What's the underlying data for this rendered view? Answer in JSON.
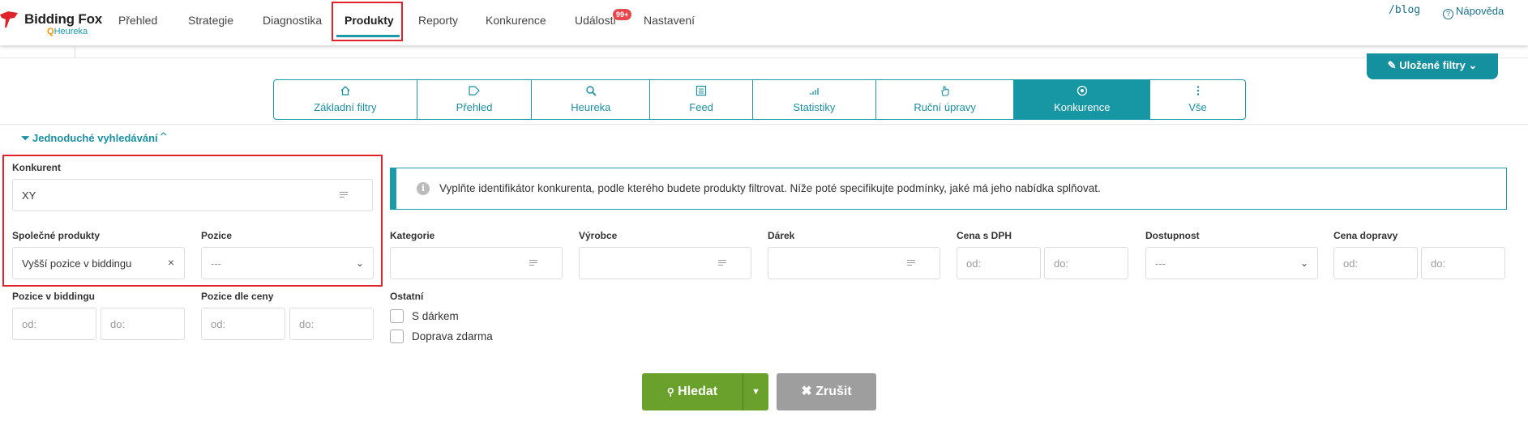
{
  "nav": {
    "brand": "Bidding Fox",
    "sub_brand": "Heureka",
    "items": [
      {
        "label": "Přehled"
      },
      {
        "label": "Strategie"
      },
      {
        "label": "Diagnostika"
      },
      {
        "label": "Produkty"
      },
      {
        "label": "Reporty"
      },
      {
        "label": "Konkurence"
      },
      {
        "label": "Události"
      },
      {
        "label": "Nastavení"
      }
    ],
    "active": "Produkty",
    "events_badge": "99+",
    "blog": "/blog",
    "help": "Nápověda"
  },
  "saved_filters": "Uložené filtry",
  "tabs": [
    {
      "label": "Základní filtry",
      "icon": "home-icon"
    },
    {
      "label": "Přehled",
      "icon": "tag-icon"
    },
    {
      "label": "Heureka",
      "icon": "search-zoom-icon"
    },
    {
      "label": "Feed",
      "icon": "list-icon"
    },
    {
      "label": "Statistiky",
      "icon": "bars-icon"
    },
    {
      "label": "Ruční úpravy",
      "icon": "hand-icon"
    },
    {
      "label": "Konkurence",
      "icon": "competition-icon"
    },
    {
      "label": "Vše",
      "icon": "dots-vertical-icon"
    }
  ],
  "active_tab": "Konkurence",
  "simple_search": "Jednoduché vyhledávání",
  "form": {
    "competitor_label": "Konkurent",
    "competitor_value": "XY",
    "common_products_label": "Společné produkty",
    "common_products_value": "Vyšší pozice v biddingu",
    "position_label": "Pozice",
    "position_value": "---",
    "bidding_position_label": "Pozice v biddingu",
    "price_position_label": "Pozice dle ceny",
    "from_placeholder": "od:",
    "to_placeholder": "do:",
    "category_label": "Kategorie",
    "manufacturer_label": "Výrobce",
    "gift_label": "Dárek",
    "price_vat_label": "Cena s DPH",
    "availability_label": "Dostupnost",
    "availability_value": "---",
    "shipping_price_label": "Cena dopravy",
    "other_label": "Ostatní",
    "with_gift": "S dárkem",
    "free_shipping": "Doprava zdarma"
  },
  "info_text": "Vyplňte identifikátor konkurenta, podle kterého budete produkty filtrovat. Níže poté specifikujte podmínky, jaké má jeho nabídka splňovat.",
  "buttons": {
    "search": "Hledat",
    "cancel": "Zrušit"
  },
  "colors": {
    "accent": "#1b9aaa",
    "search_green": "#6aa12c",
    "cancel_gray": "#9e9e9e",
    "highlight_red": "#e0232a"
  }
}
